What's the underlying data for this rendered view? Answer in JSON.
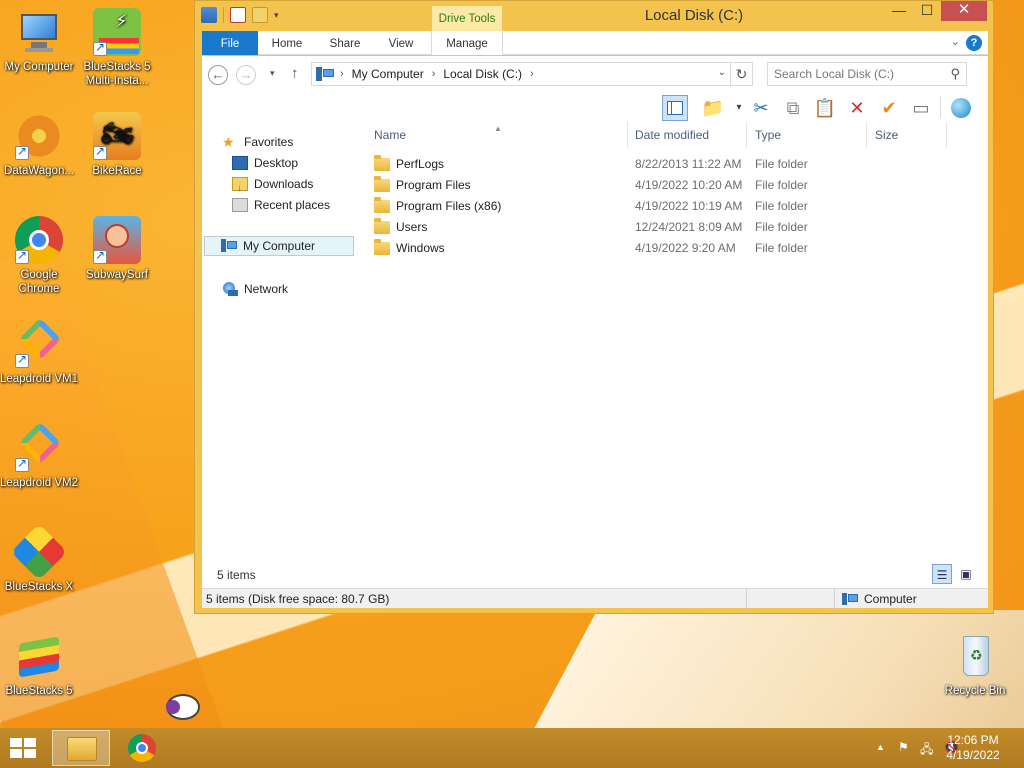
{
  "desktop": {
    "icons": [
      {
        "label": "My Computer"
      },
      {
        "label": "BlueStacks 5 Multi-Insta..."
      },
      {
        "label": "DataWagon..."
      },
      {
        "label": "BikeRace"
      },
      {
        "label": "Google Chrome"
      },
      {
        "label": "SubwaySurf"
      },
      {
        "label": "Leapdroid VM1"
      },
      {
        "label": "Leapdroid VM2"
      },
      {
        "label": "BlueStacks X"
      },
      {
        "label": "BlueStacks 5"
      },
      {
        "label": "Recycle Bin"
      }
    ]
  },
  "window": {
    "title": "Local Disk (C:)",
    "contextual_tab": "Drive Tools",
    "controls": {
      "minimize": "—",
      "maximize": "☐",
      "close": "✕"
    },
    "ribbon_tabs": [
      "File",
      "Home",
      "Share",
      "View",
      "Manage"
    ],
    "help": "?",
    "address": {
      "path": [
        "My Computer",
        "Local Disk (C:)"
      ],
      "search_placeholder": "Search Local Disk (C:)"
    },
    "nav_pane": {
      "items": [
        {
          "label": "Favorites",
          "icon": "star-icon"
        },
        {
          "label": "Desktop",
          "icon": "desktop-icon"
        },
        {
          "label": "Downloads",
          "icon": "downloads-icon"
        },
        {
          "label": "Recent places",
          "icon": "recent-places-icon"
        },
        {
          "label": "My Computer",
          "icon": "computer-icon"
        },
        {
          "label": "Network",
          "icon": "network-icon"
        }
      ]
    },
    "columns": [
      "Name",
      "Date modified",
      "Type",
      "Size"
    ],
    "files": [
      {
        "name": "PerfLogs",
        "date": "8/22/2013 11:22 AM",
        "type": "File folder"
      },
      {
        "name": "Program Files",
        "date": "4/19/2022 10:20 AM",
        "type": "File folder"
      },
      {
        "name": "Program Files (x86)",
        "date": "4/19/2022 10:19 AM",
        "type": "File folder"
      },
      {
        "name": "Users",
        "date": "12/24/2021 8:09 AM",
        "type": "File folder"
      },
      {
        "name": "Windows",
        "date": "4/19/2022 9:20 AM",
        "type": "File folder"
      }
    ],
    "item_count": "5 items",
    "status_left": "5 items (Disk free space: 80.7 GB)",
    "status_right": "Computer"
  },
  "taskbar": {
    "time": "12:06 PM",
    "date": "4/19/2022"
  },
  "colors": {
    "accent": "#1979ca",
    "desktop": "#f7a21b",
    "close": "#c75050"
  }
}
